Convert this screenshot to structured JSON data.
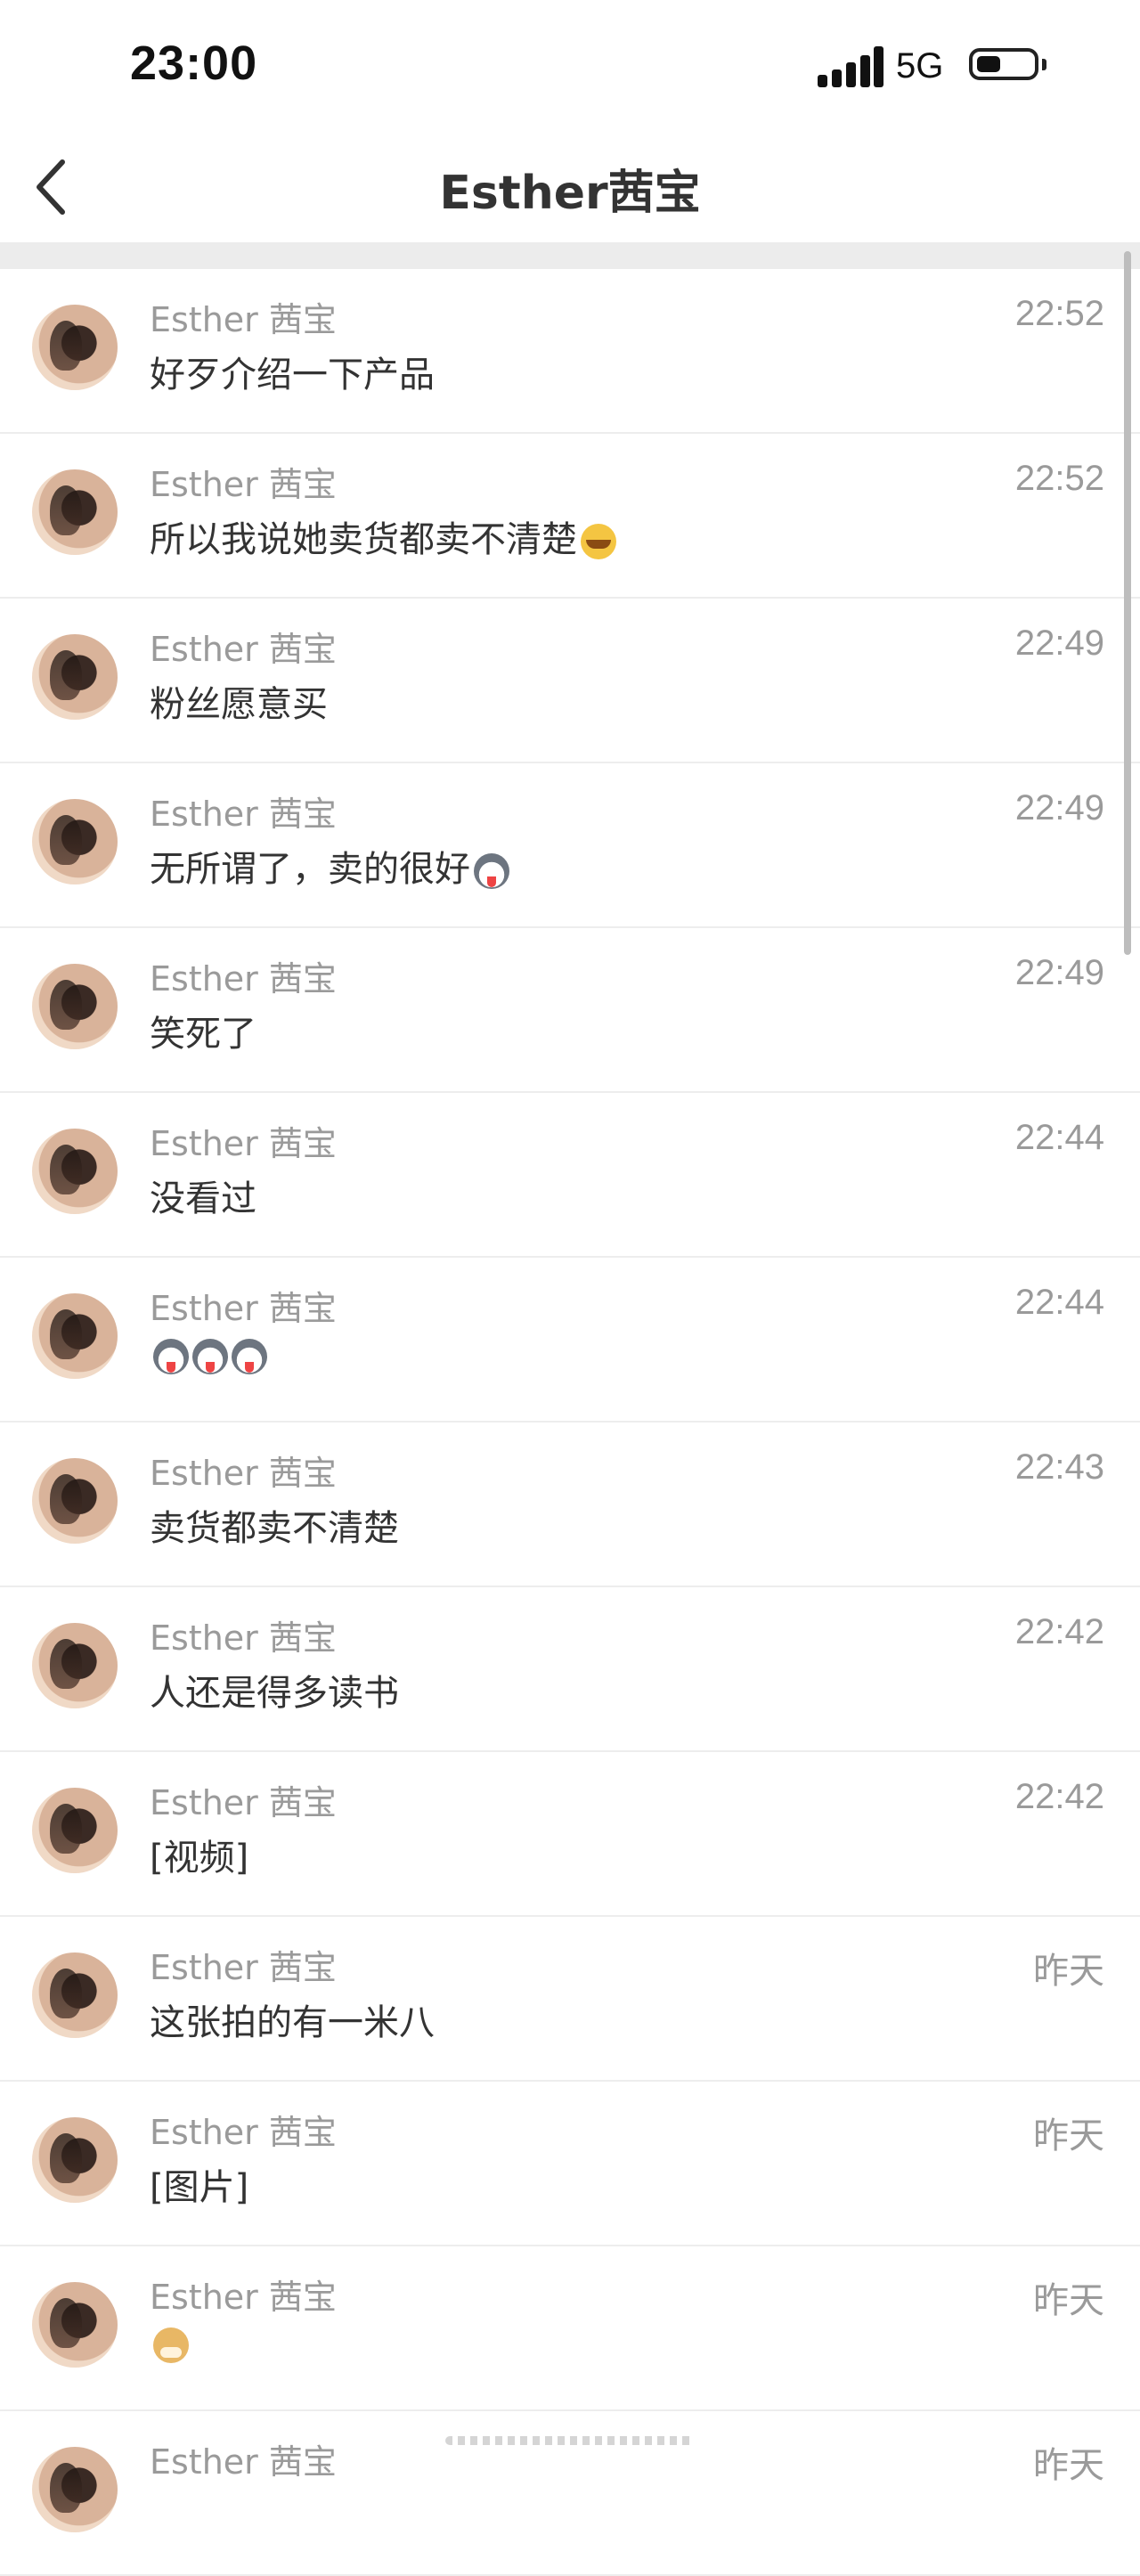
{
  "status_bar": {
    "time": "23:00",
    "network": "5G"
  },
  "nav": {
    "title": "Esther茜宝"
  },
  "messages": [
    {
      "name": "Esther 茜宝",
      "time": "22:52",
      "text": "好歹介绍一下产品",
      "emoji": []
    },
    {
      "name": "Esther 茜宝",
      "time": "22:52",
      "text": "所以我说她卖货都卖不清楚",
      "emoji": [
        "face-tears"
      ]
    },
    {
      "name": "Esther 茜宝",
      "time": "22:49",
      "text": "粉丝愿意买",
      "emoji": []
    },
    {
      "name": "Esther 茜宝",
      "time": "22:49",
      "text": "无所谓了，卖的很好",
      "emoji": [
        "face-husky"
      ]
    },
    {
      "name": "Esther 茜宝",
      "time": "22:49",
      "text": "笑死了",
      "emoji": []
    },
    {
      "name": "Esther 茜宝",
      "time": "22:44",
      "text": "没看过",
      "emoji": []
    },
    {
      "name": "Esther 茜宝",
      "time": "22:44",
      "text": "",
      "emoji": [
        "face-husky",
        "face-husky",
        "face-husky"
      ]
    },
    {
      "name": "Esther 茜宝",
      "time": "22:43",
      "text": "卖货都卖不清楚",
      "emoji": []
    },
    {
      "name": "Esther 茜宝",
      "time": "22:42",
      "text": "人还是得多读书",
      "emoji": []
    },
    {
      "name": "Esther 茜宝",
      "time": "22:42",
      "text": "[视频]",
      "emoji": []
    },
    {
      "name": "Esther 茜宝",
      "time": "昨天",
      "text": "这张拍的有一米八",
      "emoji": []
    },
    {
      "name": "Esther 茜宝",
      "time": "昨天",
      "text": "[图片]",
      "emoji": []
    },
    {
      "name": "Esther 茜宝",
      "time": "昨天",
      "text": "",
      "emoji": [
        "face-doge"
      ]
    },
    {
      "name": "Esther 茜宝",
      "time": "昨天",
      "text": "",
      "emoji": []
    }
  ]
}
